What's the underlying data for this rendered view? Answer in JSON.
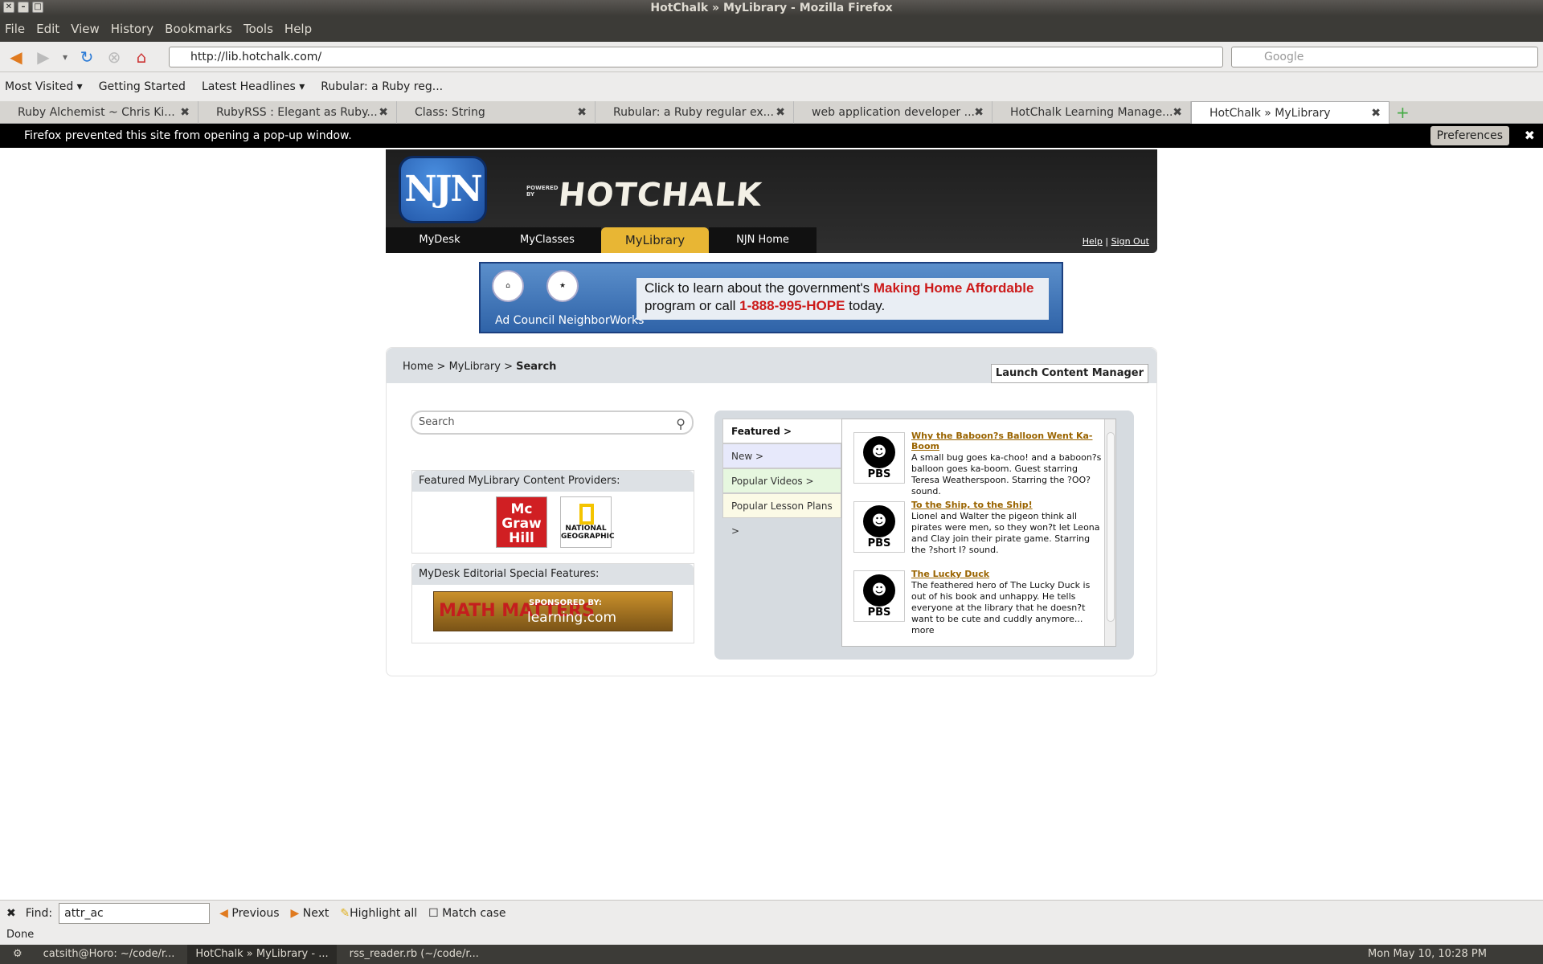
{
  "window": {
    "title": "HotChalk » MyLibrary - Mozilla Firefox"
  },
  "menu": [
    "File",
    "Edit",
    "View",
    "History",
    "Bookmarks",
    "Tools",
    "Help"
  ],
  "nav": {
    "url": "http://lib.hotchalk.com/",
    "search_placeholder": "Google"
  },
  "bookmarks": [
    "Most Visited ▾",
    "Getting Started",
    "Latest Headlines ▾",
    "Rubular: a Ruby reg..."
  ],
  "tabs": [
    "Ruby Alchemist ~ Chris Ki...",
    "RubyRSS : Elegant as Ruby...",
    "Class: String",
    "Rubular: a Ruby regular ex...",
    "web application developer ...",
    "HotChalk Learning Manage...",
    "HotChalk » MyLibrary"
  ],
  "popup": {
    "message": "Firefox prevented this site from opening a pop-up window.",
    "preferences": "Preferences"
  },
  "site": {
    "logo": "NJN",
    "powered": "POWERED BY",
    "brand": "HOTCHALK",
    "topnav": [
      "MyDesk",
      "MyClasses",
      "MyLibrary",
      "NJN Home"
    ],
    "help": "Help",
    "signout": "Sign Out",
    "ad": {
      "l1": "Click to learn about the government's ",
      "l1red": "Making Home Affordable",
      "l2": "program or call ",
      "l2red": "1-888-995-HOPE",
      "l2end": " today.",
      "logos": "Ad Council   NeighborWorks"
    },
    "breadcrumb": {
      "home": "Home",
      "lib": "MyLibrary",
      "current": "Search"
    },
    "launch": "Launch Content Manager",
    "search_placeholder": "Search",
    "providers": {
      "title": "Featured MyLibrary Content Providers:",
      "mcgraw": "Mc Graw Hill",
      "ng": "NATIONAL GEOGRAPHIC"
    },
    "editorial": {
      "title": "MyDesk Editorial Special Features:",
      "brand": "MATH MATTERS",
      "sponsored": "SPONSORED BY:",
      "sponsor": "learning.com"
    },
    "feattabs": [
      "Featured >",
      "New >",
      "Popular Videos >",
      "Popular Lesson Plans >"
    ],
    "items": [
      {
        "title": "Why the Baboon?s Balloon Went Ka-Boom",
        "desc": "A small bug goes ka-choo! and a baboon?s balloon goes ka-boom. Guest starring Teresa Weatherspoon. Starring the ?OO? sound."
      },
      {
        "title": "To the Ship, to the Ship!",
        "desc": "Lionel and Walter the pigeon think all pirates were men, so they won?t let Leona and Clay join their pirate game. Starring the ?short I? sound."
      },
      {
        "title": "The Lucky Duck",
        "desc": "The feathered hero of The Lucky Duck is out of his book and unhappy. He tells everyone at the library that he doesn?t want to be cute and cuddly anymore... more"
      }
    ],
    "pbs": "PBS"
  },
  "find": {
    "label": "Find:",
    "value": "attr_ac",
    "previous": "Previous",
    "next": "Next",
    "highlight": "Highlight all",
    "matchcase": "Match case"
  },
  "status": "Done",
  "taskbar": {
    "t1": "catsith@Horo: ~/code/r...",
    "t2": "HotChalk » MyLibrary - ...",
    "t3": "rss_reader.rb (~/code/r...",
    "clock": "Mon May 10, 10:28 PM"
  }
}
